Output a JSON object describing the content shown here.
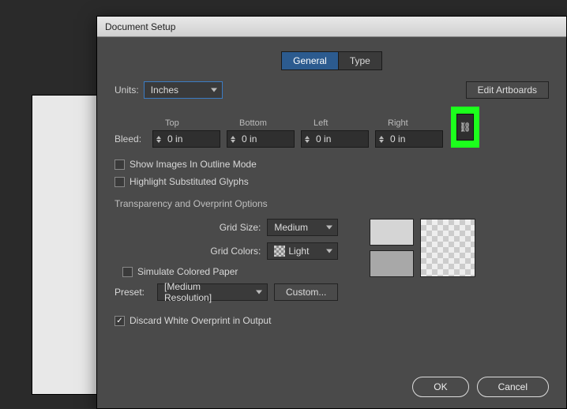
{
  "dialog": {
    "title": "Document Setup",
    "tabs": {
      "general": "General",
      "type": "Type"
    },
    "units": {
      "label": "Units:",
      "value": "Inches"
    },
    "editArtboards": "Edit Artboards",
    "bleed": {
      "label": "Bleed:",
      "top": {
        "label": "Top",
        "value": "0 in"
      },
      "bottom": {
        "label": "Bottom",
        "value": "0 in"
      },
      "left": {
        "label": "Left",
        "value": "0 in"
      },
      "right": {
        "label": "Right",
        "value": "0 in"
      }
    },
    "showImagesOutline": "Show Images In Outline Mode",
    "highlightGlyphs": "Highlight Substituted Glyphs",
    "transparencyTitle": "Transparency and Overprint Options",
    "gridSize": {
      "label": "Grid Size:",
      "value": "Medium"
    },
    "gridColors": {
      "label": "Grid Colors:",
      "value": "Light"
    },
    "simulatePaper": "Simulate Colored Paper",
    "preset": {
      "label": "Preset:",
      "value": "[Medium Resolution]"
    },
    "custom": "Custom...",
    "discardWhite": "Discard White Overprint in Output",
    "ok": "OK",
    "cancel": "Cancel"
  }
}
